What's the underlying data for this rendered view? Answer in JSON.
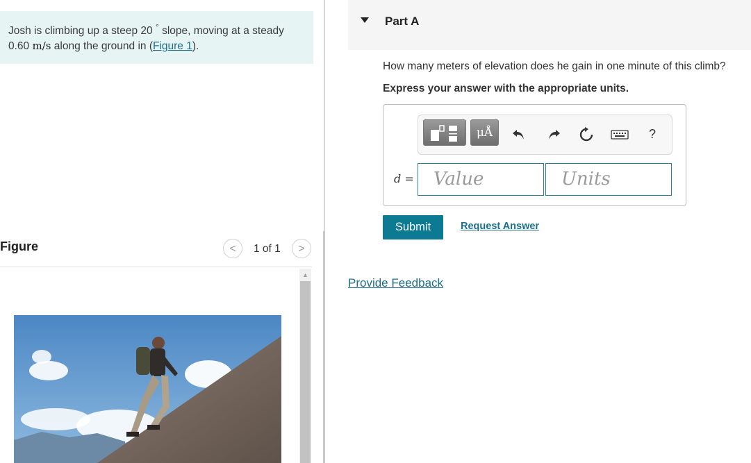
{
  "problem": {
    "text_before": "Josh is climbing up a steep 20 ",
    "degree": "°",
    "text_mid": " slope, moving at a steady 0.60 ",
    "unit_m": "m",
    "unit_slash": "/",
    "unit_s": "s",
    "text_after": " along the ground in (",
    "figure_link": "Figure 1",
    "text_end": ")."
  },
  "figure": {
    "title": "Figure",
    "page": "1 of 1",
    "prev_icon": "<",
    "next_icon": ">",
    "scroll_up": "▲"
  },
  "part": {
    "title": "Part A",
    "question": "How many meters of elevation does he gain in one minute of this climb?",
    "instruction": "Express your answer with the appropriate units."
  },
  "answer": {
    "variable": "d",
    "equals": " =",
    "value_placeholder": "Value",
    "units_placeholder": "Units",
    "units_tool": "μÅ",
    "help": "?"
  },
  "actions": {
    "submit": "Submit",
    "request_answer": "Request Answer",
    "feedback": "Provide Feedback"
  },
  "colors": {
    "accent": "#0b7a92",
    "link": "#1d6f8a",
    "problem_bg": "#e6f4f4"
  }
}
